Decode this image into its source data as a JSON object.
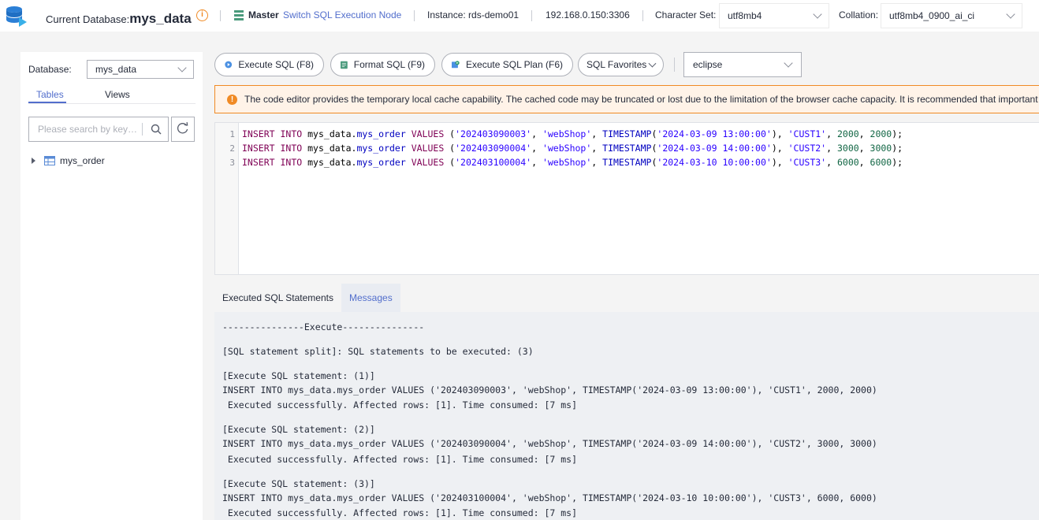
{
  "header": {
    "current_db_label": "Current Database:",
    "current_db_name": "mys_data",
    "master_label": "Master",
    "switch_link": "Switch SQL Execution Node",
    "instance": "Instance: rds-demo01",
    "ip": "192.168.0.150:3306",
    "charset_label": "Character Set:",
    "charset_value": "utf8mb4",
    "collation_label": "Collation:",
    "collation_value": "utf8mb4_0900_ai_ci"
  },
  "sidebar": {
    "db_label": "Database:",
    "db_value": "mys_data",
    "tabs": [
      {
        "label": "Tables",
        "active": true
      },
      {
        "label": "Views",
        "active": false
      }
    ],
    "search_placeholder": "Please search by key…",
    "tree": [
      {
        "label": "mys_order"
      }
    ]
  },
  "toolbar": {
    "execute_label": "Execute SQL (F8)",
    "format_label": "Format SQL (F9)",
    "plan_label": "Execute SQL Plan (F6)",
    "favorites_label": "SQL Favorites",
    "theme_value": "eclipse"
  },
  "warning": {
    "text": "The code editor provides the temporary local cache capability. The cached code may be truncated or lost due to the limitation of the browser cache capacity. It is recommended that important"
  },
  "editor": {
    "line_numbers": [
      "1",
      "2",
      "3"
    ],
    "lines": [
      {
        "id": "202403090003",
        "shop": "webShop",
        "ts": "2024-03-09 13:00:00",
        "cust": "CUST1",
        "a": "2000",
        "b": "2000"
      },
      {
        "id": "202403090004",
        "shop": "webShop",
        "ts": "2024-03-09 14:00:00",
        "cust": "CUST2",
        "a": "3000",
        "b": "3000"
      },
      {
        "id": "202403100004",
        "shop": "webShop",
        "ts": "2024-03-10 10:00:00",
        "cust": "CUST3",
        "a": "6000",
        "b": "6000"
      }
    ],
    "kw_insert": "INSERT",
    "kw_into": "INTO",
    "schema": "mys_data",
    "table": "mys_order",
    "kw_values": "VALUES",
    "fn_timestamp": "TIMESTAMP"
  },
  "results": {
    "tabs": [
      {
        "label": "Executed SQL Statements",
        "active": false
      },
      {
        "label": "Messages",
        "active": true
      }
    ],
    "messages": [
      "---------------Execute---------------",
      "[SQL statement split]: SQL statements to be executed: (3)",
      "[Execute SQL statement: (1)]",
      "INSERT INTO mys_data.mys_order VALUES ('202403090003', 'webShop', TIMESTAMP('2024-03-09 13:00:00'), 'CUST1', 2000, 2000)",
      " Executed successfully. Affected rows: [1]. Time consumed: [7 ms]",
      "[Execute SQL statement: (2)]",
      "INSERT INTO mys_data.mys_order VALUES ('202403090004', 'webShop', TIMESTAMP('2024-03-09 14:00:00'), 'CUST2', 3000, 3000)",
      " Executed successfully. Affected rows: [1]. Time consumed: [7 ms]",
      "[Execute SQL statement: (3)]",
      "INSERT INTO mys_data.mys_order VALUES ('202403100004', 'webShop', TIMESTAMP('2024-03-10 10:00:00'), 'CUST3', 6000, 6000)",
      " Executed successfully. Affected rows: [1]. Time consumed: [7 ms]"
    ]
  },
  "colors": {
    "accent": "#526ecc",
    "warning": "#f08a24",
    "warning_bg": "#fff3e8",
    "workspace_bg": "#f4f4f4"
  },
  "icons": [
    "database-logo-icon",
    "info-icon",
    "master-node-icon",
    "chevron-down-icon",
    "search-icon",
    "refresh-icon",
    "table-icon",
    "play-icon",
    "format-icon",
    "plan-icon",
    "warning-icon"
  ]
}
